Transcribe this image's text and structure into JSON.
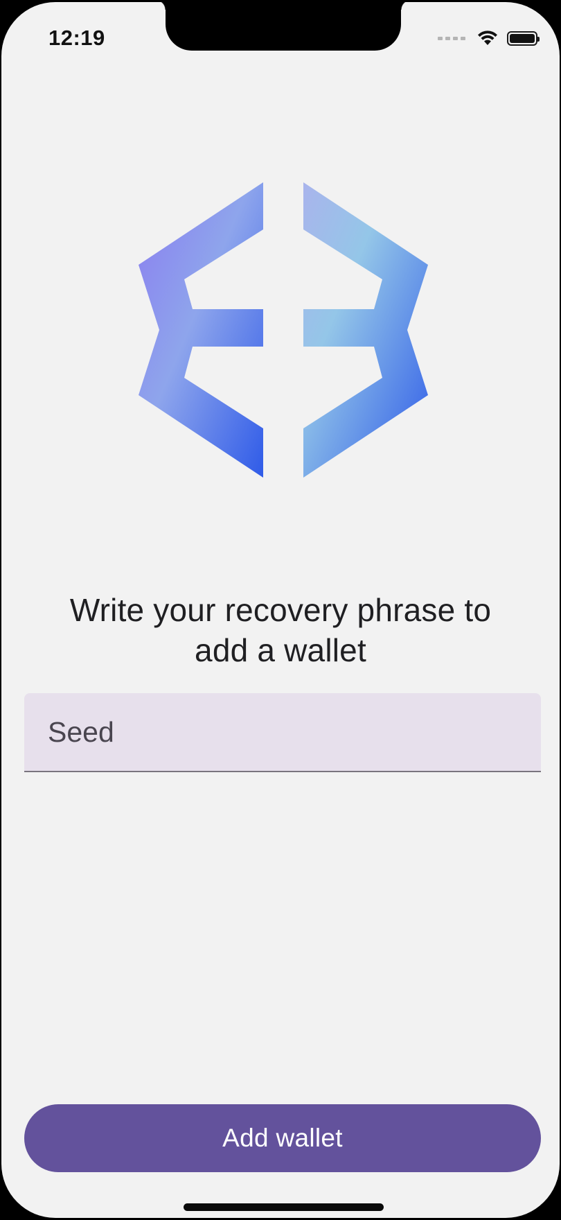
{
  "status_bar": {
    "time": "12:19",
    "icons": [
      "cellular-signal-icon",
      "wifi-icon",
      "battery-icon"
    ]
  },
  "logo": {
    "icon": "exodus-logo",
    "colors": {
      "purple": "#8a7cf0",
      "light_blue": "#94c6e8",
      "blue": "#2f5be8"
    }
  },
  "heading": {
    "text": "Write your recovery phrase to add a wallet"
  },
  "seed_input": {
    "value": "",
    "placeholder": "Seed"
  },
  "add_wallet_button": {
    "label": "Add wallet",
    "color": "#63529c"
  },
  "colors": {
    "background": "#f2f2f2",
    "input_fill": "#e7e0ec",
    "text": "#1f1f22"
  }
}
